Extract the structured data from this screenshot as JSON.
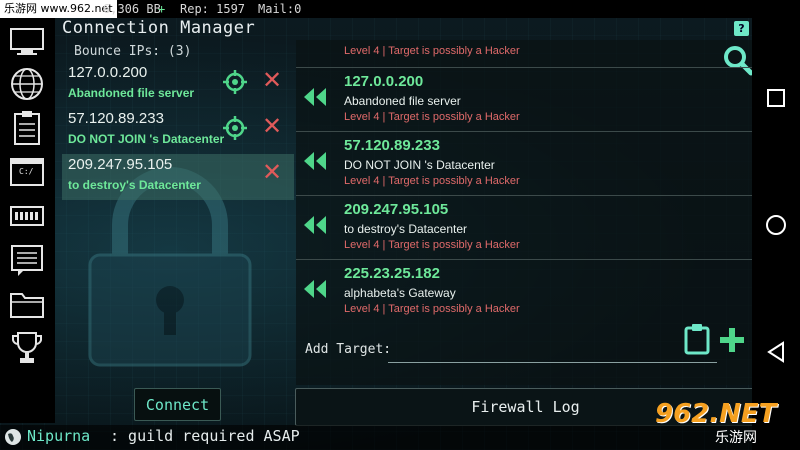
{
  "status_bar": {
    "watermark": "乐游网 www.962.net",
    "balance": "6,306 BB",
    "balance_trend": "+",
    "rep": "Rep: 1597",
    "mail": "Mail:0",
    "help_icon": "?"
  },
  "sidebar": {
    "items": [
      {
        "icon": "monitor-icon"
      },
      {
        "icon": "globe-icon"
      },
      {
        "icon": "clipboard-list-icon"
      },
      {
        "icon": "terminal-icon",
        "label": "C:/"
      },
      {
        "icon": "hardware-icon"
      },
      {
        "icon": "chat-log-icon"
      },
      {
        "icon": "folder-icon"
      },
      {
        "icon": "trophy-icon"
      }
    ]
  },
  "header": {
    "title": "Connection Manager",
    "bounce_label": "Bounce IPs: (3)"
  },
  "bounce_ips": [
    {
      "ip": "127.0.0.200",
      "name": "Abandoned file server",
      "selected": false,
      "has_target": true
    },
    {
      "ip": "57.120.89.233",
      "name": "DO NOT JOIN 's Datacenter",
      "selected": false,
      "has_target": true
    },
    {
      "ip": "209.247.95.105",
      "name": "to destroy's Datacenter",
      "selected": true,
      "has_target": false
    }
  ],
  "connections": {
    "partial_top_level": "Level 4 | Target is possibly a Hacker",
    "items": [
      {
        "ip": "127.0.0.200",
        "name": "Abandoned file server",
        "level": "Level 4 | Target is possibly a Hacker"
      },
      {
        "ip": "57.120.89.233",
        "name": "DO NOT JOIN 's Datacenter",
        "level": "Level 4 | Target is possibly a Hacker"
      },
      {
        "ip": "209.247.95.105",
        "name": "to destroy's Datacenter",
        "level": "Level 4 | Target is possibly a Hacker"
      },
      {
        "ip": "225.23.25.182",
        "name": "alphabeta's Gateway",
        "level": "Level 4 | Target is possibly a Hacker"
      }
    ]
  },
  "add_target": {
    "label": "Add Target:",
    "value": "",
    "placeholder": ""
  },
  "buttons": {
    "connect": "Connect",
    "firewall_log": "Firewall Log"
  },
  "chat": {
    "user": "Nipurna",
    "message": ": guild required ASAP"
  },
  "watermark_br": {
    "top": "962.NET",
    "bottom": "乐游网"
  },
  "colors": {
    "accent_green": "#6ee89a",
    "accent_teal": "#6ee8c8",
    "danger_red": "#e05a5a",
    "level_text": "#e06a6a"
  }
}
